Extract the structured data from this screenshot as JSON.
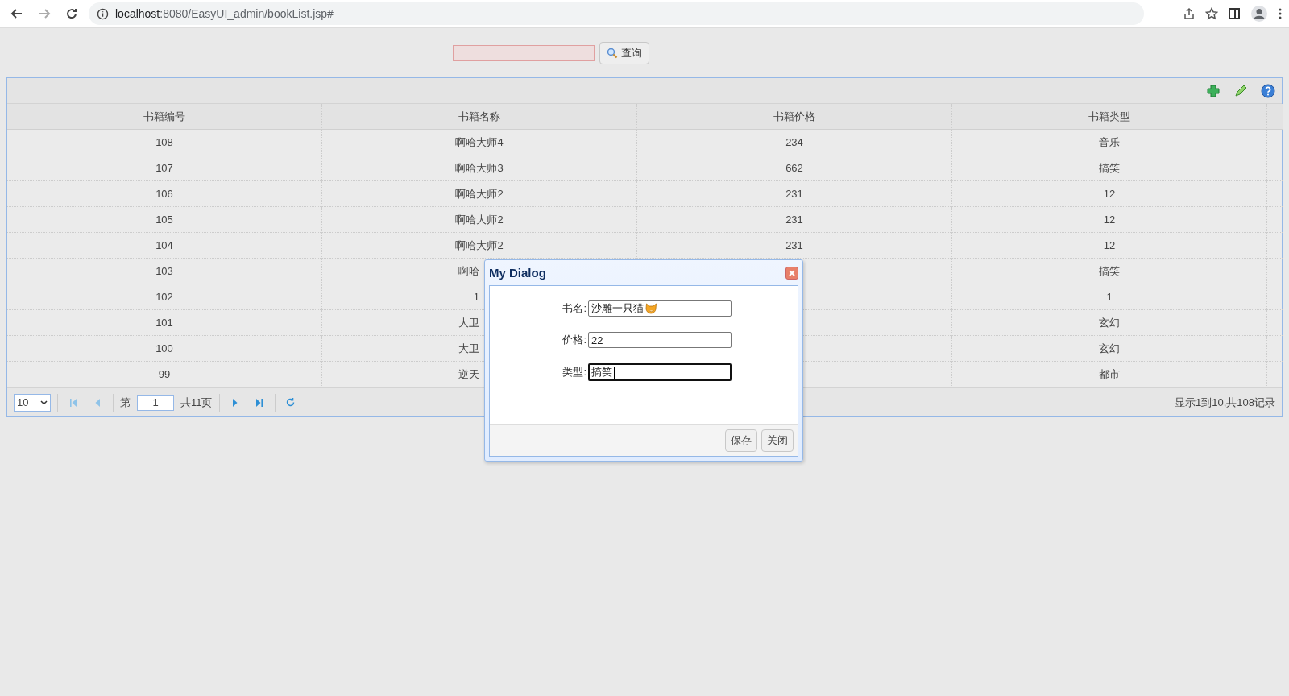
{
  "browser": {
    "url_host": "localhost",
    "url_path": ":8080/EasyUI_admin/bookList.jsp#",
    "forward_disabled": true
  },
  "search": {
    "invalid": true,
    "button": "查询"
  },
  "toolbar": {
    "actions": [
      {
        "kind": "add"
      },
      {
        "kind": "edit"
      },
      {
        "kind": "help"
      }
    ]
  },
  "table": {
    "columns": [
      "书籍编号",
      "书籍名称",
      "书籍价格",
      "书籍类型"
    ],
    "rows": [
      {
        "id": "108",
        "name": "啊哈大师4",
        "price": "234",
        "type": "音乐",
        "covered": false
      },
      {
        "id": "107",
        "name": "啊哈大师3",
        "price": "662",
        "type": "搞笑",
        "covered": false
      },
      {
        "id": "106",
        "name": "啊哈大师2",
        "price": "231",
        "type": "12",
        "covered": false
      },
      {
        "id": "105",
        "name": "啊哈大师2",
        "price": "231",
        "type": "12",
        "covered": false
      },
      {
        "id": "104",
        "name": "啊哈大师2",
        "price": "231",
        "type": "12",
        "covered": false
      },
      {
        "id": "103",
        "name": "啊哈",
        "type": "搞笑",
        "covered": true
      },
      {
        "id": "102",
        "name": "1",
        "type": "1",
        "covered": true
      },
      {
        "id": "101",
        "name": "大卫",
        "type": "玄幻",
        "covered": true
      },
      {
        "id": "100",
        "name": "大卫",
        "type": "玄幻",
        "covered": true
      },
      {
        "id": "99",
        "name": "逆天",
        "type": "都市",
        "covered": true
      }
    ]
  },
  "pager": {
    "page_size": "10",
    "page_prefix": "第",
    "page": "1",
    "page_total": "共11页",
    "summary": "显示1到10,共108记录"
  },
  "dialog": {
    "title": "My Dialog",
    "fields": [
      {
        "label": "书名:",
        "value": "沙雕一只猫",
        "cat_icon": true,
        "focused": false
      },
      {
        "label": "价格:",
        "value": "22",
        "cat_icon": false,
        "focused": false
      },
      {
        "label": "类型:",
        "value": "搞笑",
        "cat_icon": false,
        "focused": true
      }
    ],
    "buttons": [
      "保存",
      "关闭"
    ]
  }
}
